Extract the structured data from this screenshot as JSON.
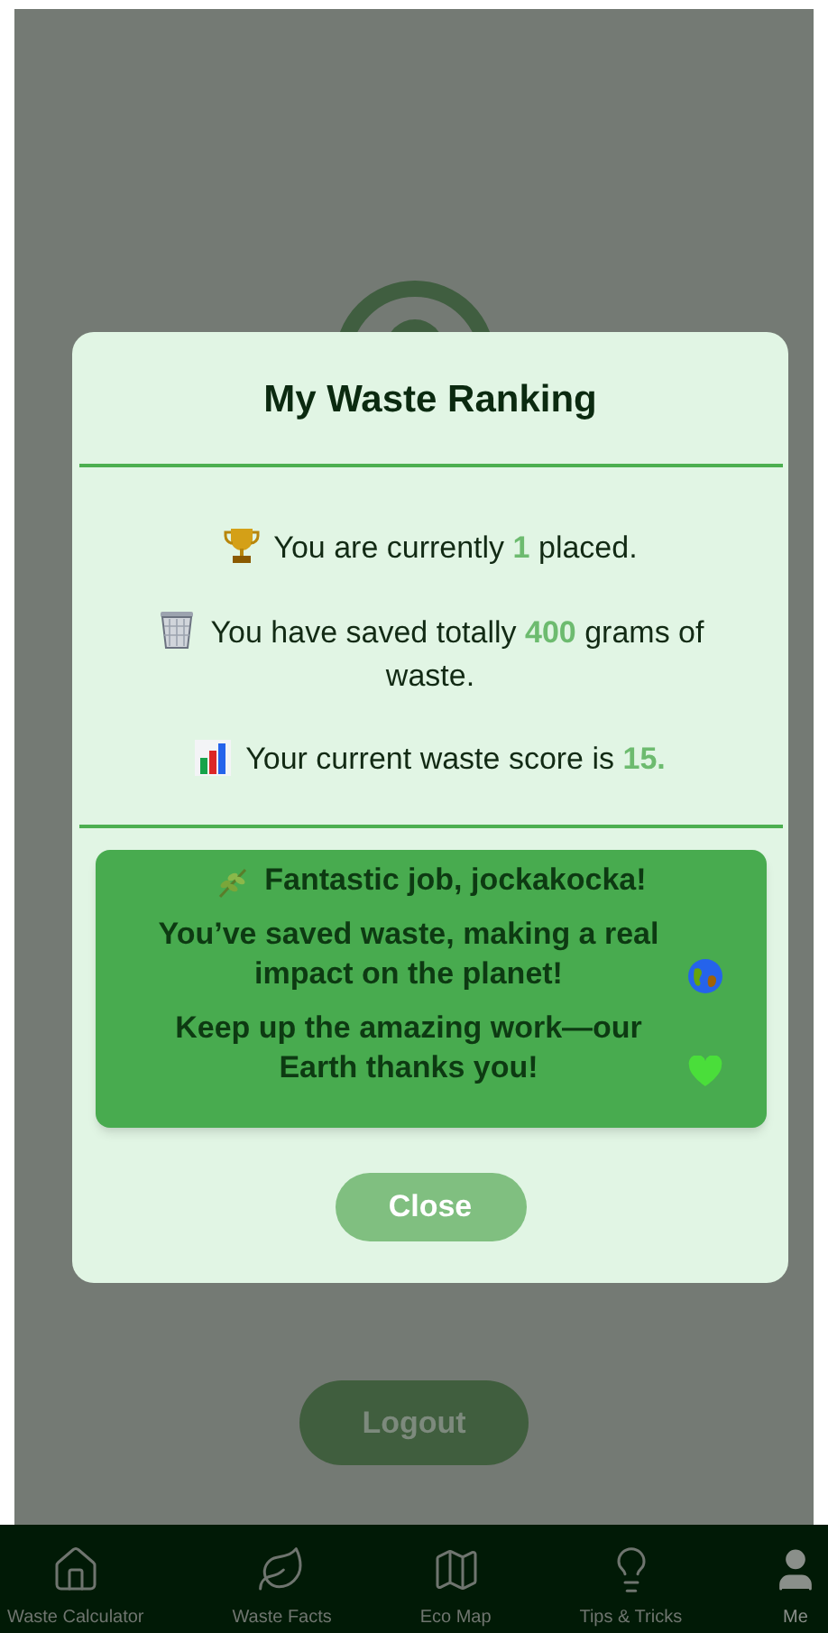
{
  "dialog": {
    "title": "My Waste Ranking",
    "stats": [
      {
        "kind": "trophy",
        "before": "You are currently ",
        "value": "1",
        "after": " placed."
      },
      {
        "kind": "trash",
        "before": "You have saved totally ",
        "value": "400",
        "after": " grams of waste."
      },
      {
        "kind": "chart",
        "before": "Your current waste score is ",
        "value": "15."
      }
    ],
    "message": [
      {
        "kind": "leaf",
        "text": "Fantastic job, jockakocka!"
      },
      {
        "kind": "globe",
        "text": "You’ve saved waste, making a real impact on the planet!"
      },
      {
        "kind": "heart",
        "text": "Keep up the amazing work—our Earth thanks you!"
      }
    ],
    "close_button": "Close"
  },
  "logout_button": "Logout",
  "tab_bar": [
    {
      "kind": "home",
      "label": "Waste Calculator",
      "selected": false
    },
    {
      "kind": "leaf",
      "label": "Waste Facts",
      "selected": false
    },
    {
      "kind": "map",
      "label": "Eco Map",
      "selected": false
    },
    {
      "kind": "bulb",
      "label": "Tips & Tricks",
      "selected": false
    },
    {
      "kind": "user",
      "label": "Me",
      "selected": true
    }
  ]
}
